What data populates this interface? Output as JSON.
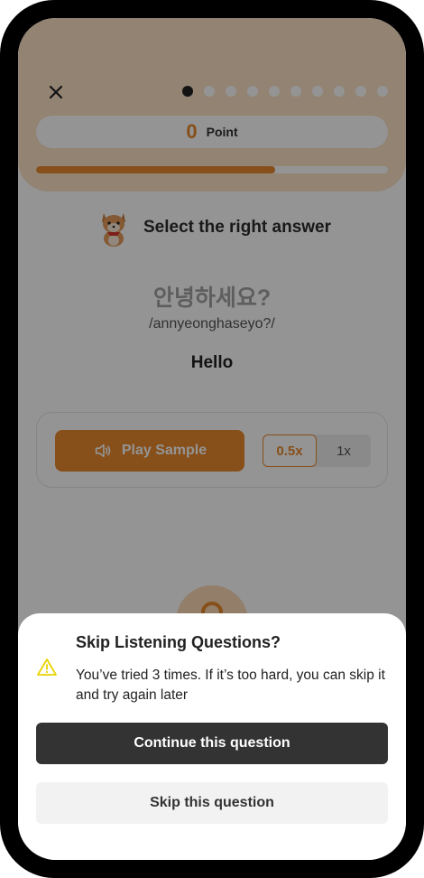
{
  "header": {
    "progress_dots_total": 10,
    "progress_dots_active_index": 0,
    "point_value": "0",
    "point_label": "Point",
    "progress_fraction": 0.68
  },
  "question": {
    "instruction": "Select the right answer",
    "korean": "안녕하세요?",
    "romanization": "/annyeonghaseyo?/",
    "meaning": "Hello"
  },
  "audio": {
    "play_label": "Play Sample",
    "speeds": [
      "0.5x",
      "1x"
    ],
    "selected_speed": "0.5x"
  },
  "sheet": {
    "title": "Skip Listening Questions?",
    "message": "You’ve tried 3 times. If it’s too hard, you can skip it and try again later",
    "continue_label": "Continue this question",
    "skip_label": "Skip this question"
  },
  "colors": {
    "accent": "#e8892b",
    "warning": "#e8d400",
    "dark_button": "#333333"
  },
  "icons": {
    "close": "close-icon",
    "speaker": "speaker-icon",
    "warning": "warning-icon",
    "mascot": "shiba-mascot"
  }
}
